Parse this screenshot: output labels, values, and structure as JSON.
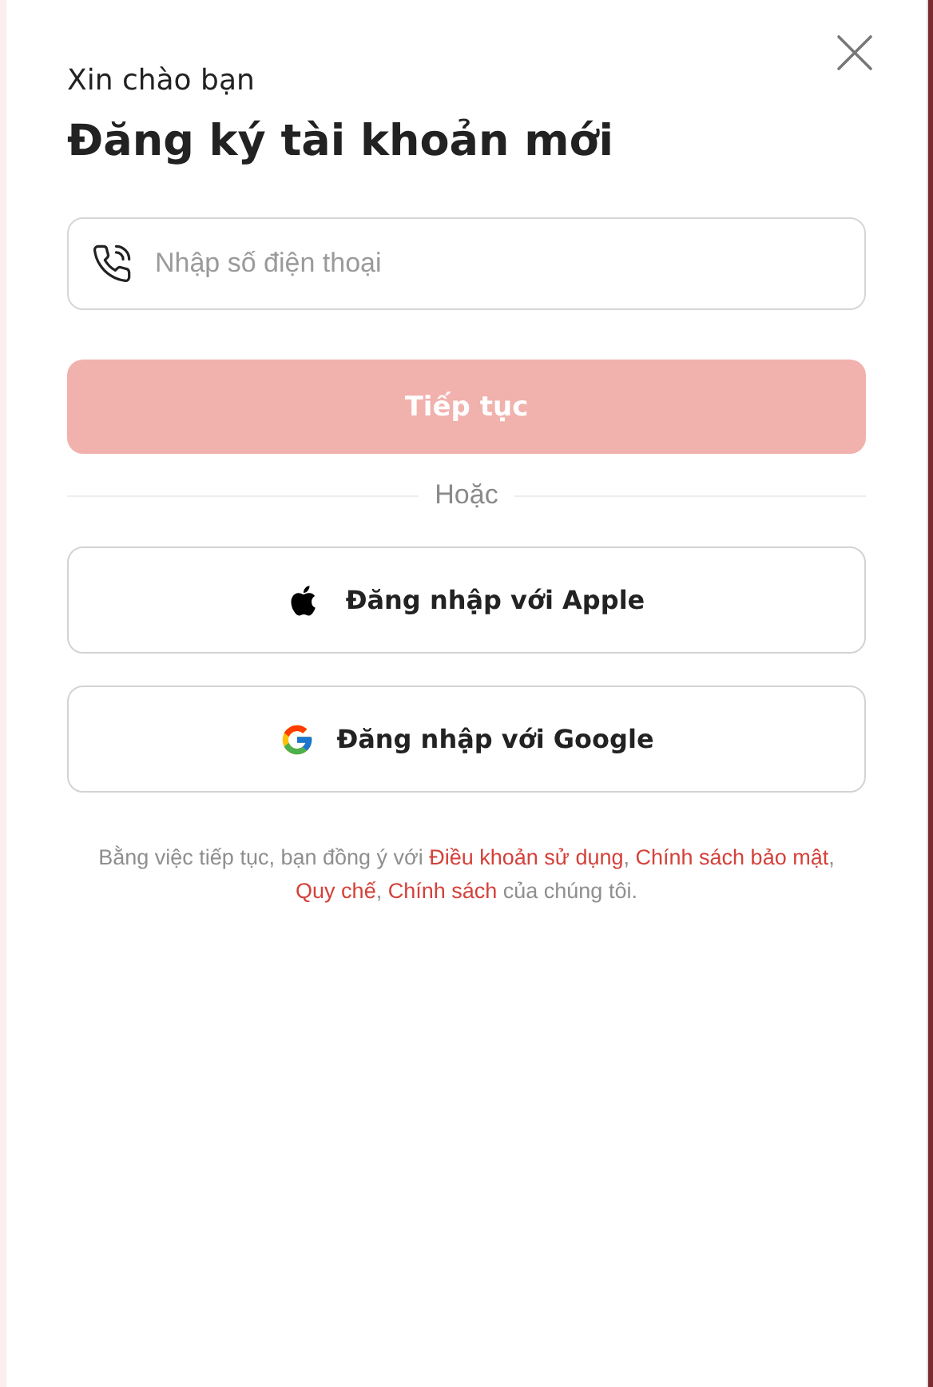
{
  "greeting": "Xin chào bạn",
  "title": "Đăng ký tài khoản mới",
  "phone_field": {
    "placeholder": "Nhập số điện thoại"
  },
  "continue_button": {
    "label": "Tiếp tục",
    "disabled": true
  },
  "divider_label": "Hoặc",
  "social_buttons": [
    {
      "kind": "apple",
      "label": "Đăng nhập với Apple"
    },
    {
      "kind": "google",
      "label": "Đăng nhập với Google"
    }
  ],
  "terms": [
    {
      "kind": "text",
      "text": "Bằng việc tiếp tục, bạn đồng ý với "
    },
    {
      "kind": "link",
      "text": "Điều khoản sử dụng"
    },
    {
      "kind": "text",
      "text": ", "
    },
    {
      "kind": "link",
      "text": "Chính sách bảo mật"
    },
    {
      "kind": "text",
      "text": ", "
    },
    {
      "kind": "link",
      "text": "Quy chế"
    },
    {
      "kind": "text",
      "text": ", "
    },
    {
      "kind": "link",
      "text": "Chính sách"
    },
    {
      "kind": "text",
      "text": " của chúng tôi."
    }
  ]
}
